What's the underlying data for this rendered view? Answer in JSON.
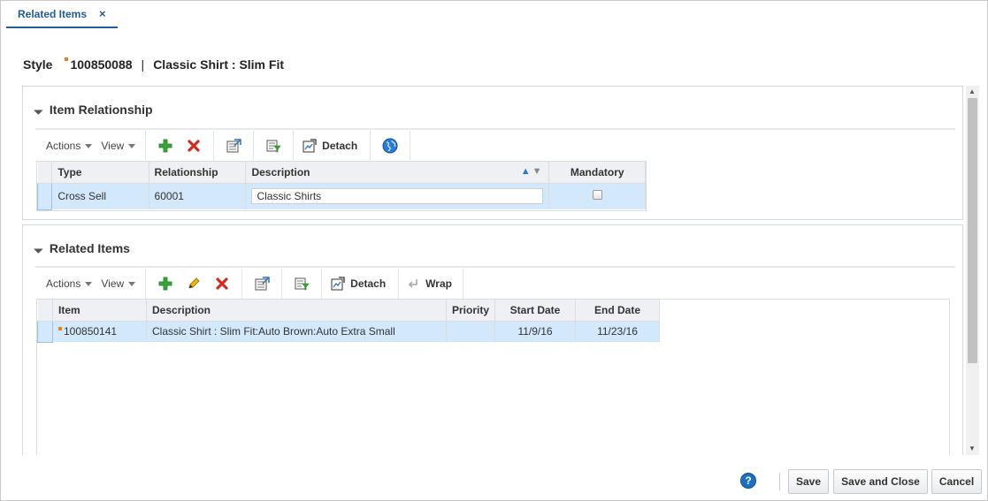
{
  "tab": {
    "label": "Related Items",
    "close_glyph": "×"
  },
  "header": {
    "style_label": "Style",
    "item_id": "100850088",
    "separator": "|",
    "item_desc": "Classic Shirt : Slim Fit"
  },
  "relationship_panel": {
    "title": "Item Relationship",
    "toolbar": {
      "actions": "Actions",
      "view": "View",
      "detach": "Detach"
    },
    "columns": [
      "Type",
      "Relationship",
      "Description",
      "Mandatory"
    ],
    "rows": [
      {
        "type": "Cross Sell",
        "relationship": "60001",
        "description": "Classic Shirts",
        "mandatory": false
      }
    ]
  },
  "related_panel": {
    "title": "Related Items",
    "toolbar": {
      "actions": "Actions",
      "view": "View",
      "detach": "Detach",
      "wrap": "Wrap"
    },
    "columns": [
      "Item",
      "Description",
      "Priority",
      "Start Date",
      "End Date"
    ],
    "rows": [
      {
        "item": "100850141",
        "description": "Classic Shirt : Slim Fit:Auto Brown:Auto Extra Small",
        "priority": "",
        "start_date": "11/9/16",
        "end_date": "11/23/16"
      }
    ]
  },
  "footer": {
    "help": "?",
    "save": "Save",
    "save_close": "Save and Close",
    "cancel": "Cancel"
  },
  "colors": {
    "accent": "#1f5c99",
    "selection": "#d3e8fb",
    "orange_marker": "#f07f1a"
  }
}
